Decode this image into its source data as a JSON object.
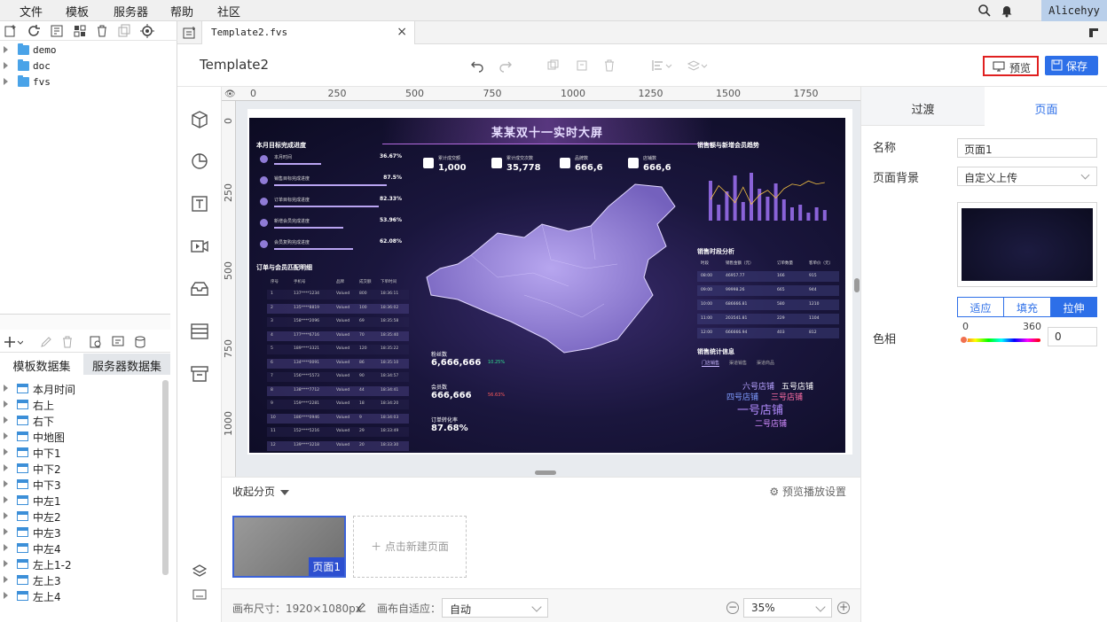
{
  "menubar": {
    "items": [
      "文件",
      "模板",
      "服务器",
      "帮助",
      "社区"
    ],
    "user": "Alicehyy"
  },
  "file_tree": [
    {
      "label": "demo"
    },
    {
      "label": "doc"
    },
    {
      "label": "fvs"
    }
  ],
  "dataset_tabs": [
    "模板数据集",
    "服务器数据集"
  ],
  "datasets": [
    "本月时间",
    "右上",
    "右下",
    "中地图",
    "中下1",
    "中下2",
    "中下3",
    "中左1",
    "中左2",
    "中左3",
    "中左4",
    "左上1-2",
    "左上3",
    "左上4"
  ],
  "tab": {
    "title": "Template2.fvs",
    "close": "×"
  },
  "editor": {
    "title": "Template2",
    "preview_label": "预览",
    "save_label": "保存"
  },
  "ruler": {
    "top_ticks": [
      "0",
      "250",
      "500",
      "750",
      "1000",
      "1250",
      "1500",
      "1750"
    ],
    "left_ticks": [
      "0",
      "250",
      "500",
      "750",
      "1000"
    ]
  },
  "dashboard": {
    "title": "某某双十一实时大屏",
    "sec_progress": "本月目标完成进度",
    "progress": [
      {
        "name": "本月时间",
        "pct": "36.67%",
        "frac": 0.37
      },
      {
        "name": "销售目标完成进度",
        "pct": "87.5%",
        "frac": 0.88
      },
      {
        "name": "订单目标完成进度",
        "pct": "82.33%",
        "frac": 0.82
      },
      {
        "name": "新增会员完成进度",
        "pct": "53.96%",
        "frac": 0.54
      },
      {
        "name": "会员复购完成进度",
        "pct": "62.08%",
        "frac": 0.62
      }
    ],
    "kpis": [
      {
        "label": "累计成交额",
        "value": "1,000"
      },
      {
        "label": "累计成交次数",
        "value": "35,778"
      },
      {
        "label": "品牌数",
        "value": "666,6"
      },
      {
        "label": "店铺数",
        "value": "666,6"
      }
    ],
    "sec_orders": "订单与会员匹配明细",
    "table_head": [
      "序号",
      "手机号",
      "品牌",
      "成交额",
      "下单时间"
    ],
    "table_rows": [
      [
        "1",
        "137****1234",
        "Valued",
        "800",
        "18:36:11"
      ],
      [
        "2",
        "135****8819",
        "Valued",
        "100",
        "18:36:02"
      ],
      [
        "3",
        "158****2096",
        "Valued",
        "69",
        "18:35:58"
      ],
      [
        "4",
        "177****6716",
        "Valued",
        "70",
        "18:35:40"
      ],
      [
        "5",
        "189****3321",
        "Valued",
        "120",
        "18:35:22"
      ],
      [
        "6",
        "134****0091",
        "Valued",
        "86",
        "18:35:10"
      ],
      [
        "7",
        "156****5573",
        "Valued",
        "90",
        "18:34:57"
      ],
      [
        "8",
        "138****7712",
        "Valued",
        "44",
        "18:34:41"
      ],
      [
        "9",
        "159****2281",
        "Valued",
        "18",
        "18:34:20"
      ],
      [
        "10",
        "186****0946",
        "Valued",
        "9",
        "18:34:03"
      ],
      [
        "11",
        "152****5216",
        "Valued",
        "29",
        "18:33:49"
      ],
      [
        "12",
        "139****3218",
        "Valued",
        "20",
        "18:33:30"
      ]
    ],
    "stats": [
      {
        "label": "粉丝数",
        "value": "6,666,666",
        "delta": "10.25%"
      },
      {
        "label": "会员数",
        "value": "666,666",
        "delta": "56.63%"
      },
      {
        "label": "订单转化率",
        "value": "87.68%",
        "delta": ""
      }
    ],
    "sec_trend": "销售额与新增会员趋势",
    "trend_bars": [
      0.75,
      0.3,
      0.55,
      0.85,
      0.35,
      0.9,
      0.6,
      0.45,
      0.7,
      0.4,
      0.25,
      0.3,
      0.15,
      0.25,
      0.2
    ],
    "sec_time": "销售时段分析",
    "time_head": [
      "时段",
      "销售金额（元）",
      "订单数量",
      "客单价（元）"
    ],
    "time_rows": [
      [
        "08:00",
        "46957.77",
        "166",
        "915"
      ],
      [
        "09:00",
        "99998.26",
        "665",
        "944"
      ],
      [
        "10:00",
        "686666.81",
        "580",
        "1210"
      ],
      [
        "11:00",
        "203541.81",
        "229",
        "1104"
      ],
      [
        "12:00",
        "666666.94",
        "403",
        "812"
      ]
    ],
    "sec_shop": "销售统计信息",
    "shop_tabs": [
      "门店销售",
      "渠道销售",
      "渠道商品"
    ],
    "word_cloud": [
      {
        "t": "六号店铺",
        "c": "#b6a2ff"
      },
      {
        "t": "五号店铺",
        "c": "#ffffff"
      },
      {
        "t": "四号店铺",
        "c": "#7f9cff"
      },
      {
        "t": "三号店铺",
        "c": "#ff6fa6"
      },
      {
        "t": "一号店铺",
        "c": "#b38cff"
      },
      {
        "t": "二号店铺",
        "c": "#d28cff"
      }
    ]
  },
  "pages_panel": {
    "collapse": "收起分页",
    "settings": "预览播放设置",
    "page_tag": "页面1",
    "new_page": "＋ 点击新建页面"
  },
  "bottom_bar": {
    "canvas_size": "画布尺寸：1920×1080px",
    "auto_fit_label": "画布自适应：",
    "auto_fit_value": "自动",
    "zoom": "35%"
  },
  "right_panel": {
    "tabs": [
      "过渡",
      "页面"
    ],
    "name_label": "名称",
    "name_value": "页面1",
    "bg_label": "页面背景",
    "bg_value": "自定义上传",
    "fit_options": [
      "适应",
      "填充",
      "拉伸"
    ],
    "hue_label": "色相",
    "hue_min": "0",
    "hue_max": "360",
    "hue_value": "0"
  },
  "colors": {
    "accent": "#2d6fe8",
    "highlight": "#e02020",
    "user_bg": "#b9cfea"
  }
}
